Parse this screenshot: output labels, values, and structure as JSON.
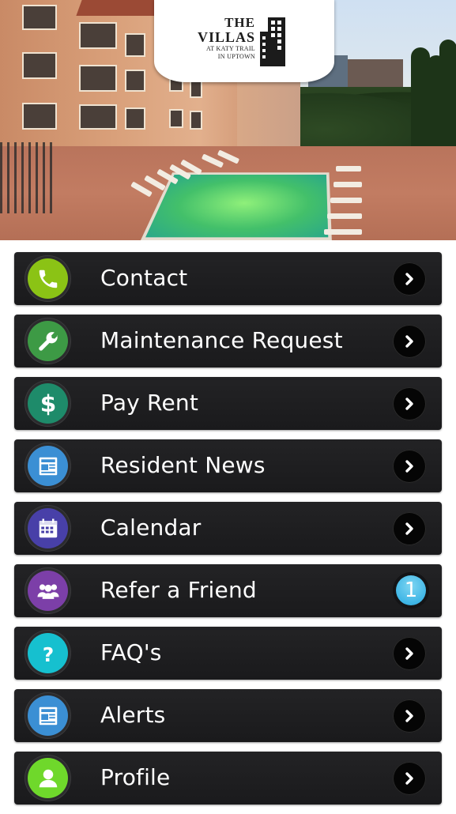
{
  "header": {
    "logo_line1": "THE",
    "logo_line2": "VILLAS",
    "logo_line3": "AT KATY TRAIL",
    "logo_line4": "IN UPTOWN"
  },
  "menu": {
    "items": [
      {
        "label": "Contact",
        "icon": "phone-icon",
        "color": "#8bc315"
      },
      {
        "label": "Maintenance Request",
        "icon": "wrench-icon",
        "color": "#3d9a45"
      },
      {
        "label": "Pay Rent",
        "icon": "dollar-icon",
        "color": "#1e8b6a"
      },
      {
        "label": "Resident News",
        "icon": "newspaper-icon",
        "color": "#3b8fd4"
      },
      {
        "label": "Calendar",
        "icon": "calendar-icon",
        "color": "#4840a8"
      },
      {
        "label": "Refer a Friend",
        "icon": "group-icon",
        "color": "#7c3fa8",
        "badge": "1"
      },
      {
        "label": "FAQ's",
        "icon": "question-icon",
        "color": "#16c0cf"
      },
      {
        "label": "Alerts",
        "icon": "newspaper-icon",
        "color": "#3b8fd4"
      },
      {
        "label": "Profile",
        "icon": "user-icon",
        "color": "#6fd82b"
      }
    ]
  },
  "colors": {
    "row_background": "#1f1f21",
    "badge_blue": "#3fb6e6"
  }
}
